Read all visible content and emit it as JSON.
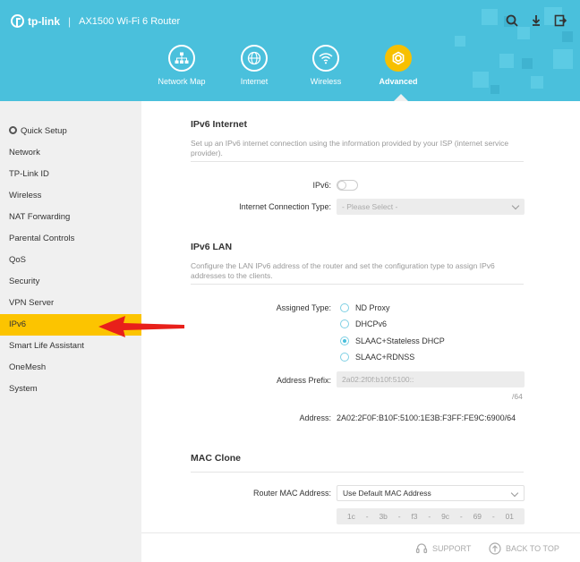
{
  "header": {
    "brand": "tp-link",
    "separator": "|",
    "model": "AX1500 Wi-Fi 6 Router",
    "icons": [
      "search-icon",
      "download-icon",
      "logout-icon"
    ]
  },
  "nav": {
    "items": [
      {
        "label": "Network Map",
        "icon": "network-map-icon",
        "active": false
      },
      {
        "label": "Internet",
        "icon": "globe-icon",
        "active": false
      },
      {
        "label": "Wireless",
        "icon": "wifi-icon",
        "active": false
      },
      {
        "label": "Advanced",
        "icon": "advanced-gear-icon",
        "active": true
      }
    ]
  },
  "sidebar": {
    "items": [
      {
        "label": "Quick Setup"
      },
      {
        "label": "Network"
      },
      {
        "label": "TP-Link ID"
      },
      {
        "label": "Wireless"
      },
      {
        "label": "NAT Forwarding"
      },
      {
        "label": "Parental Controls"
      },
      {
        "label": "QoS"
      },
      {
        "label": "Security"
      },
      {
        "label": "VPN Server"
      },
      {
        "label": "IPv6"
      },
      {
        "label": "Smart Life Assistant"
      },
      {
        "label": "OneMesh"
      },
      {
        "label": "System"
      }
    ],
    "active_index": 9
  },
  "ipv6_internet": {
    "title": "IPv6 Internet",
    "desc": "Set up an IPv6 internet connection using the information provided by your ISP (internet service provider).",
    "ipv6_label": "IPv6:",
    "ipv6_enabled": false,
    "conn_type_label": "Internet Connection Type:",
    "conn_type_value": "- Please Select -"
  },
  "ipv6_lan": {
    "title": "IPv6 LAN",
    "desc": "Configure the LAN IPv6 address of the router and set the configuration type to assign IPv6 addresses to the clients.",
    "assigned_type_label": "Assigned Type:",
    "options": [
      {
        "label": "ND Proxy",
        "selected": false
      },
      {
        "label": "DHCPv6",
        "selected": false
      },
      {
        "label": "SLAAC+Stateless DHCP",
        "selected": true
      },
      {
        "label": "SLAAC+RDNSS",
        "selected": false
      }
    ],
    "prefix_label": "Address Prefix:",
    "prefix_value": "2a02:2f0f:b10f:5100::",
    "prefix_suffix": "/64",
    "address_label": "Address:",
    "address_value": "2A02:2F0F:B10F:5100:1E3B:F3FF:FE9C:6900/64"
  },
  "mac_clone": {
    "title": "MAC Clone",
    "router_mac_label": "Router MAC Address:",
    "router_mac_value": "Use Default MAC Address",
    "mac_parts": [
      "1c",
      "-",
      "3b",
      "-",
      "f3",
      "-",
      "9c",
      "-",
      "69",
      "-",
      "01"
    ]
  },
  "footer": {
    "support": "SUPPORT",
    "back_to_top": "BACK TO TOP"
  },
  "colors": {
    "header_bg": "#4ac0dc",
    "accent_yellow": "#fcc400",
    "arrow_red": "#e8201a"
  }
}
